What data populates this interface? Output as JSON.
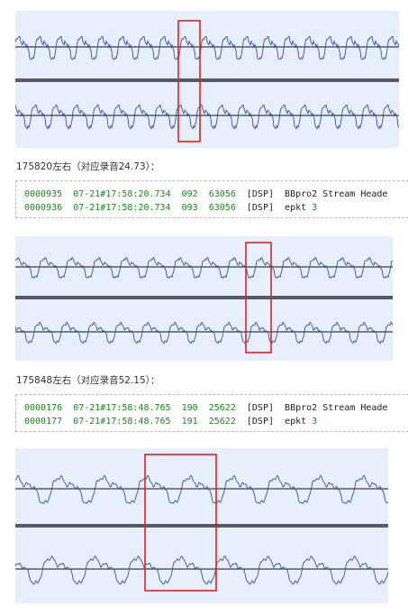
{
  "sections": [
    {
      "caption": "",
      "log_lines": []
    },
    {
      "caption": "175820左右（对应录音24.73）：",
      "log_lines": [
        {
          "idx": "0000935",
          "time": "07-21#17:58:20.734",
          "seq": "092",
          "val": "63056",
          "tag": "[DSP]",
          "msg": "BBpro2 Stream Heade",
          "msg_num": ""
        },
        {
          "idx": "0000936",
          "time": "07-21#17:58:20.734",
          "seq": "093",
          "val": "63056",
          "tag": "[DSP]",
          "msg": "epkt ",
          "msg_num": "3"
        }
      ]
    },
    {
      "caption": "175848左右（对应录音52.15）：",
      "log_lines": [
        {
          "idx": "0000176",
          "time": "07-21#17:58:48.765",
          "seq": "190",
          "val": "25622",
          "tag": "[DSP]",
          "msg": "BBpro2 Stream Heade",
          "msg_num": ""
        },
        {
          "idx": "0000177",
          "time": "07-21#17:58:48.765",
          "seq": "191",
          "val": "25622",
          "tag": "[DSP]",
          "msg": "epkt ",
          "msg_num": "3"
        }
      ]
    }
  ],
  "colors": {
    "wave": "#3a4fa8",
    "panel_bg": "#e8effc",
    "highlight_box": "#e02020",
    "divider": "#555a66",
    "log_number": "#1a8a1a"
  }
}
